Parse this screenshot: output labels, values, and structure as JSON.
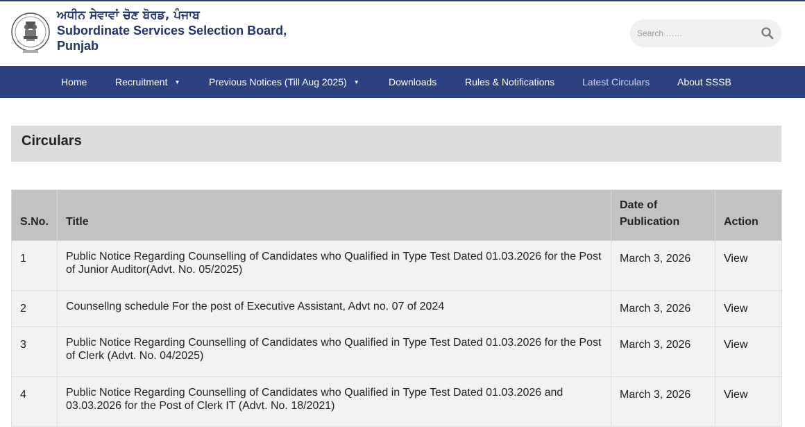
{
  "header": {
    "title_punjabi": "ਅਧੀਨ ਸੇਵਾਵਾਂ ਚੋਣ ਬੋਰਡ, ਪੰਜਾਬ",
    "title_english": "Subordinate Services Selection Board, Punjab",
    "emblem_icon": "state-emblem-icon",
    "accent_color": "#2c4280"
  },
  "search": {
    "placeholder": "Search ……",
    "icon": "search-icon"
  },
  "nav": {
    "items": [
      {
        "label": "Home"
      },
      {
        "label": "Recruitment",
        "has_dropdown": true
      },
      {
        "label": "Previous Notices (Till Aug 2025)",
        "has_dropdown": true
      },
      {
        "label": "Downloads"
      },
      {
        "label": "Rules & Notifications"
      },
      {
        "label": "Latest Circulars",
        "active": true
      },
      {
        "label": "About SSSB"
      }
    ],
    "caret_glyph": "▼"
  },
  "page": {
    "heading": "Circulars"
  },
  "table": {
    "headers": {
      "sno": "S.No.",
      "title": "Title",
      "date": "Date of Publication",
      "action": "Action"
    },
    "rows": [
      {
        "sno": "1",
        "title": "Public Notice Regarding Counselling of Candidates who Qualified in Type Test Dated 01.03.2026 for the Post of Junior Auditor(Advt. No. 05/2025)",
        "date": "March 3, 2026",
        "action": "View"
      },
      {
        "sno": "2",
        "title": "Counsellng schedule For the post of Executive Assistant, Advt no. 07 of 2024",
        "date": "March 3, 2026",
        "action": "View"
      },
      {
        "sno": "3",
        "title": "Public Notice Regarding Counselling of Candidates who Qualified in Type Test Dated 01.03.2026 for the Post of Clerk (Advt. No. 04/2025)",
        "date": "March 3, 2026",
        "action": "View"
      },
      {
        "sno": "4",
        "title": "Public Notice Regarding Counselling of Candidates who Qualified in Type Test Dated 01.03.2026 and 03.03.2026 for the Post of Clerk IT (Advt. No. 18/2021)",
        "date": "March 3, 2026",
        "action": "View"
      }
    ]
  }
}
